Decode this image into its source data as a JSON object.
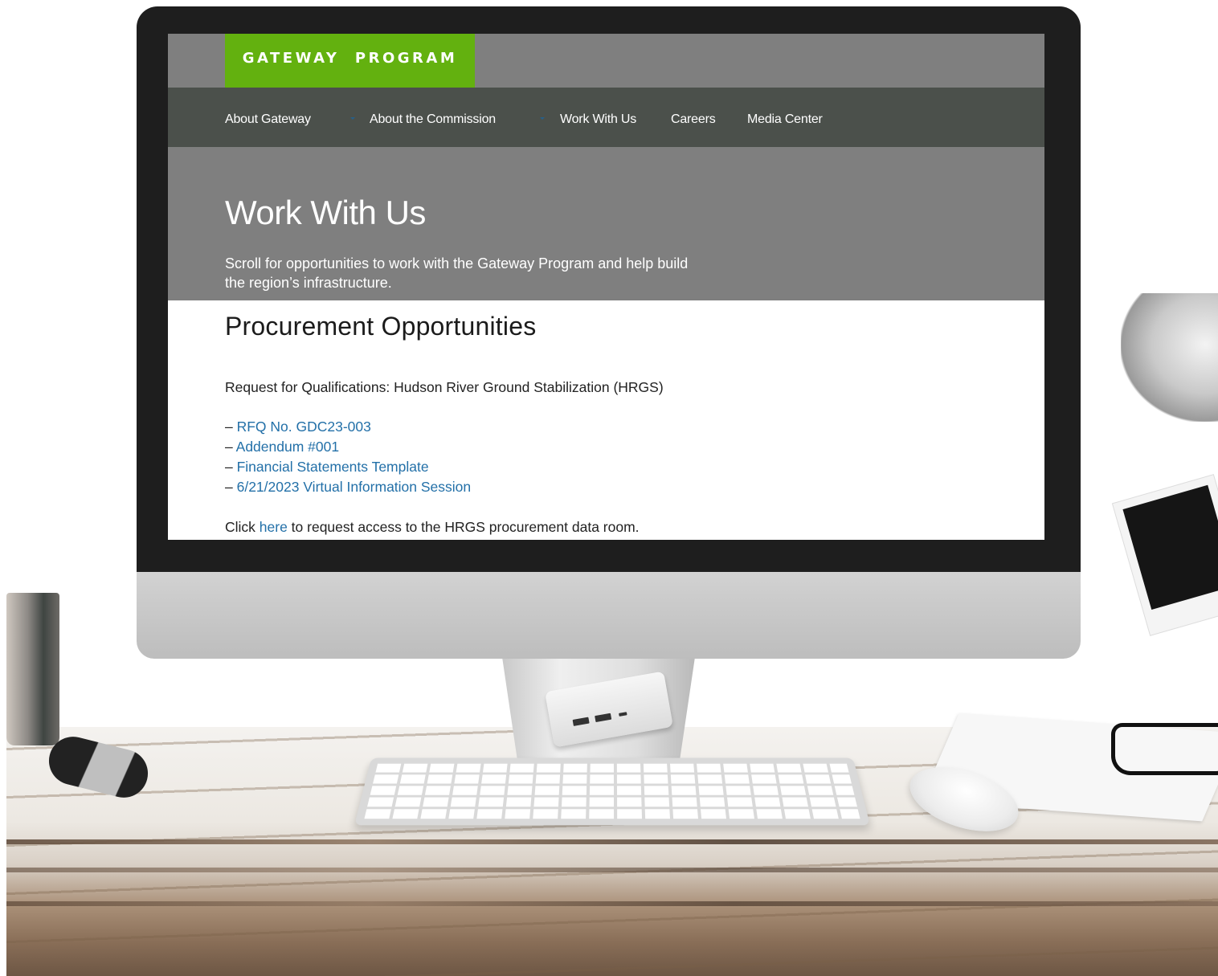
{
  "site": {
    "logo_text": "GATEWAY  PROGRAM",
    "brand_color": "#63b10f",
    "link_color": "#2370a8",
    "nav_bar_color": "#4b504b",
    "header_color": "#7f7f7f"
  },
  "nav": {
    "items": [
      {
        "label": "About Gateway",
        "has_dropdown": true
      },
      {
        "label": "About the Commission",
        "has_dropdown": true
      },
      {
        "label": "Work With Us",
        "has_dropdown": false
      },
      {
        "label": "Careers",
        "has_dropdown": false
      },
      {
        "label": "Media Center",
        "has_dropdown": false
      }
    ]
  },
  "hero": {
    "title": "Work With Us",
    "subtitle": "Scroll for opportunities to work with the Gateway Program and help build the region’s infrastructure."
  },
  "procurement": {
    "heading": "Procurement Opportunities",
    "rfq_intro": "Request for Qualifications: Hudson River Ground Stabilization (HRGS)",
    "list_prefix": "– ",
    "documents": [
      "RFQ No. GDC23-003",
      "Addendum #001",
      "Financial Statements Template",
      "6/21/2023 Virtual Information Session"
    ],
    "access_prefix": "Click ",
    "access_link": "here",
    "access_suffix": " to request access to the HRGS procurement data room."
  }
}
